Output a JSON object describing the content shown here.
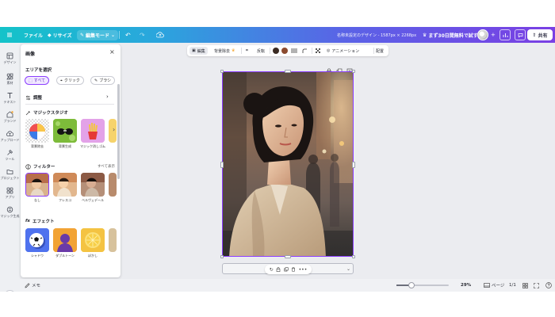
{
  "topbar": {
    "file": "ファイル",
    "resize": "リサイズ",
    "edit_mode": "編集モード",
    "doc_title": "名称未設定のデザイン - 1587px × 2268px",
    "trial": "まず30日間無料で試す",
    "share": "共有"
  },
  "rail": [
    {
      "icon": "design-icon",
      "label": "デザイン"
    },
    {
      "icon": "elements-icon",
      "label": "素材"
    },
    {
      "icon": "text-icon",
      "label": "テキスト"
    },
    {
      "icon": "brand-icon",
      "label": "ブランド"
    },
    {
      "icon": "upload-icon",
      "label": "アップロード"
    },
    {
      "icon": "tools-icon",
      "label": "ツール"
    },
    {
      "icon": "projects-icon",
      "label": "プロジェクト"
    },
    {
      "icon": "apps-icon",
      "label": "アプリ"
    },
    {
      "icon": "magic-media-icon",
      "label": "マジック生成"
    }
  ],
  "panel": {
    "title": "画像",
    "select_area": "エリアを選択",
    "chips": [
      "すべて",
      "クリック",
      "ブラシ"
    ],
    "adjust": "調整",
    "magic_studio": "マジックスタジオ",
    "magic_items": [
      "背景除去",
      "背景生成",
      "マジック消しゴム"
    ],
    "filters": "フィルター",
    "see_all": "すべて表示",
    "filter_items": [
      "なし",
      "フレスコ",
      "ベルヴェデール"
    ],
    "effects": "エフェクト",
    "effect_items": [
      "シャドウ",
      "ダブルトーン",
      "ぼかし"
    ]
  },
  "ctxbar": {
    "edit": "編集",
    "bg_remove": "背景除去",
    "flip": "反転",
    "animation": "アニメーション",
    "position": "配置",
    "colors": [
      "#3a2a22",
      "#8b4a2f"
    ]
  },
  "bottom": {
    "notes": "メモ",
    "zoom": "29%",
    "zoom_level": 0.29,
    "pages": "ページ",
    "page_count": "1/1"
  }
}
